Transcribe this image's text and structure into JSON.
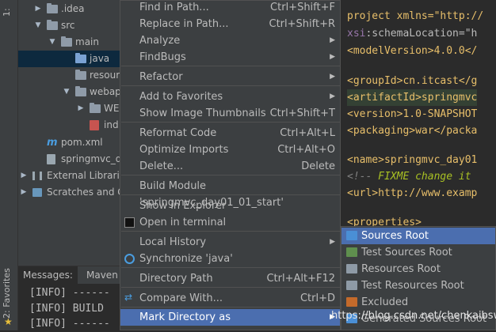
{
  "colors": {
    "accent": "#4b6eaf",
    "panel": "#3c3f41",
    "editor": "#2b2b2b",
    "selection": "#0d293e"
  },
  "left_strip": {
    "tab_top": "1:",
    "tab_bottom": "2: Favorites"
  },
  "tree": [
    {
      "label": ".idea",
      "arrow": "▶",
      "indent": 0
    },
    {
      "label": "src",
      "arrow": "▼",
      "indent": 0
    },
    {
      "label": "main",
      "arrow": "▼",
      "indent": 1
    },
    {
      "label": "java",
      "arrow": "",
      "indent": 2,
      "selected": true
    },
    {
      "label": "resour",
      "arrow": "",
      "indent": 2
    },
    {
      "label": "webap",
      "arrow": "▼",
      "indent": 2
    },
    {
      "label": "WE",
      "arrow": "▶",
      "indent": 3
    },
    {
      "label": "ind",
      "arrow": "",
      "indent": 3,
      "file": "jsp"
    },
    {
      "label": "pom.xml",
      "arrow": "",
      "indent": 0,
      "file": "maven"
    },
    {
      "label": "springmvc_d",
      "arrow": "",
      "indent": 0,
      "file": "iml"
    },
    {
      "label": "External Librari",
      "arrow": "▶",
      "indent": -1,
      "file": "lib"
    },
    {
      "label": "Scratches and C",
      "arrow": "▶",
      "indent": -1,
      "file": "scratch"
    }
  ],
  "editor": {
    "l1": "project xmlns=\"http://",
    "l2a": "xsi",
    "l2b": ":schemaLocation=\"h",
    "l3": "<modelVersion>4.0.0</",
    "l5": "<groupId>cn.itcast</g",
    "l6": "<artifactId>springmvc",
    "l7": "<version>1.0-SNAPSHOT",
    "l8": "<packaging>war</packa",
    "l10": "<name>springmvc_day01",
    "l11a": "<!-- ",
    "l11b": "FIXME change it",
    "l12": "<url>http://www.examp",
    "l14": "<properties>"
  },
  "menu": {
    "items": [
      {
        "label": "Find in Path...",
        "mn": "P",
        "shortcut": "Ctrl+Shift+F"
      },
      {
        "label": "Replace in Path...",
        "shortcut": "Ctrl+Shift+R"
      },
      {
        "label": "Analyze",
        "submenu": "▶"
      },
      {
        "label": "FindBugs",
        "submenu": "▶"
      },
      {
        "label": "Refactor",
        "submenu": "▶"
      },
      {
        "label": "Add to Favorites",
        "submenu": "▶"
      },
      {
        "label": "Show Image Thumbnails",
        "shortcut": "Ctrl+Shift+T"
      },
      {
        "label": "Reformat Code",
        "shortcut": "Ctrl+Alt+L"
      },
      {
        "label": "Optimize Imports",
        "shortcut": "Ctrl+Alt+O"
      },
      {
        "label": "Delete...",
        "shortcut": "Delete"
      },
      {
        "label": "Build Module 'springmvc_day01_01_start'"
      },
      {
        "label": "Show in Explorer"
      },
      {
        "label": "Open in terminal"
      },
      {
        "label": "Local History",
        "submenu": "▶"
      },
      {
        "label": "Synchronize 'java'"
      },
      {
        "label": "Directory Path",
        "shortcut": "Ctrl+Alt+F12"
      },
      {
        "label": "Compare With...",
        "shortcut": "Ctrl+D"
      },
      {
        "label": "Mark Directory as",
        "submenu": "▶",
        "highlighted": true
      }
    ]
  },
  "submenu": {
    "items": [
      {
        "label": "Sources Root",
        "color": "#4a8fd6",
        "highlighted": true
      },
      {
        "label": "Test Sources Root",
        "color": "#5f8f4e"
      },
      {
        "label": "Resources Root",
        "color": "#8e9aa6"
      },
      {
        "label": "Test Resources Root",
        "color": "#8e9aa6"
      },
      {
        "label": "Excluded",
        "color": "#c46a2b"
      },
      {
        "label": "Generated Sources Root",
        "color": "#4a8fd6"
      }
    ]
  },
  "bottom": {
    "tab_messages": "Messages:",
    "tab_maven": "Maven",
    "lines": [
      "[INFO] ------",
      "[INFO] BUILD",
      "[INFO] ------"
    ]
  },
  "watermark": "https://blog.csdn.net/chenkaibsw"
}
